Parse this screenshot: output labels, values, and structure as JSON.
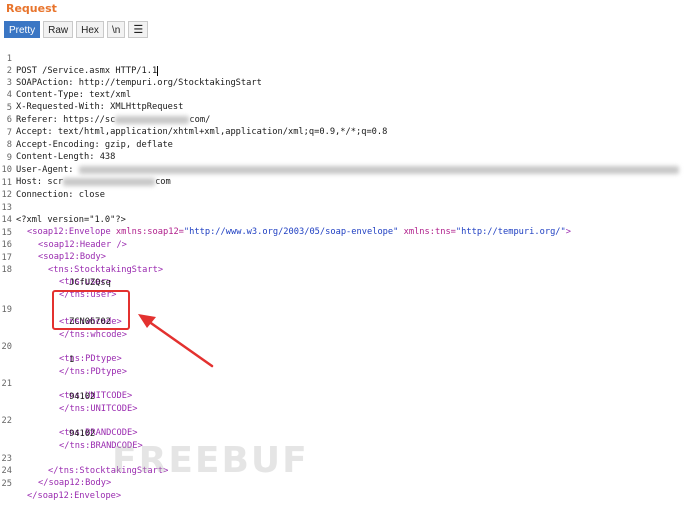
{
  "panel": {
    "title": "Request"
  },
  "toolbar": {
    "pretty": "Pretty",
    "raw": "Raw",
    "hex": "Hex",
    "newline": "\\n",
    "menu_icon": "hamburger-menu-icon"
  },
  "request": {
    "request_line": "POST /Service.asmx HTTP/1.1",
    "soapaction_key": "SOAPAction:",
    "soapaction_val": " http://tempuri.org/StocktakingStart",
    "content_type_key": "Content-Type:",
    "content_type_val": " text/xml",
    "xrw_key": "X-Requested-With:",
    "xrw_val": " XMLHttpRequest",
    "referer_key": "Referer:",
    "referer_val_a": " https://sc",
    "referer_val_b": "com/",
    "accept_key": "Accept:",
    "accept_val": " text/html,application/xhtml+xml,application/xml;q=0.9,*/*;q=0.8",
    "accept_enc_key": "Accept-Encoding:",
    "accept_enc_val": " gzip, deflate",
    "content_len_key": "Content-Length:",
    "content_len_val": " 438",
    "ua_key": "User-Agent:",
    "host_key": "Host:",
    "host_val_a": " scr",
    "host_val_b": "com",
    "connection_key": "Connection:",
    "connection_val": " close"
  },
  "xml": {
    "decl": "<?xml version=\"1.0\"?>",
    "env_open": "<soap12:Envelope",
    "env_attr1": " xmlns:soap12=",
    "env_val1": "\"http://www.w3.org/2003/05/soap-envelope\"",
    "env_attr2": " xmlns:tns=",
    "env_val2": "\"http://tempuri.org/\"",
    "env_close_bracket": ">",
    "header": "<soap12:Header />",
    "body_open": "<soap12:Body>",
    "sts_open": "<tns:StocktakingStart>",
    "user_open": "<tns:user>",
    "user_val": "JCfUZQsq",
    "user_close": "</tns:user>",
    "wh_open": "<tns:whcode>",
    "wh_val": "ZCN06702",
    "wh_close": "</tns:whcode>",
    "pd_open": "<tns:PDtype>",
    "pd_val": "1",
    "pd_close": "</tns:PDtype>",
    "unit_open": "<tns:UNITCODE>",
    "unit_val": "94102",
    "unit_close": "</tns:UNITCODE>",
    "brand_open": "<tns:BRANDCODE>",
    "brand_val": "94102",
    "brand_close": "</tns:BRANDCODE>",
    "sts_close": "</tns:StocktakingStart>",
    "body_close": "</soap12:Body>",
    "env_close": "</soap12:Envelope>"
  },
  "line_numbers": [
    "1",
    "2",
    "3",
    "4",
    "5",
    "6",
    "7",
    "8",
    "9",
    "10",
    "11",
    "12",
    "13",
    "14",
    "15",
    "16",
    "17",
    "18",
    "19",
    "20",
    "21",
    "22",
    "23",
    "24",
    "25"
  ],
  "watermark": "FREEBUF",
  "colors": {
    "accent": "#e8742c",
    "tab_active": "#3a76c4",
    "xml_tag": "#9a2bb0",
    "xml_value": "#1f3fc2",
    "annotation": "#e3312f"
  }
}
